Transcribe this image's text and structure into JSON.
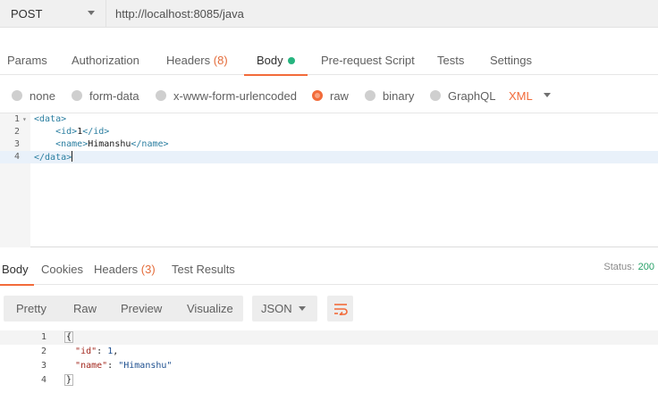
{
  "request": {
    "method": "POST",
    "url": "http://localhost:8085/java"
  },
  "request_tabs": {
    "params": "Params",
    "authorization": "Authorization",
    "headers": "Headers",
    "headers_count": "(8)",
    "body": "Body",
    "prerequest": "Pre-request Script",
    "tests": "Tests",
    "settings": "Settings"
  },
  "body_types": {
    "none": "none",
    "form_data": "form-data",
    "urlencoded": "x-www-form-urlencoded",
    "raw": "raw",
    "binary": "binary",
    "graphql": "GraphQL",
    "selected": "raw",
    "format": "XML"
  },
  "editor": {
    "lines": [
      {
        "number": "1",
        "indent": "",
        "open": "<data>",
        "text": "",
        "close": ""
      },
      {
        "number": "2",
        "indent": "    ",
        "open": "<id>",
        "text": "1",
        "close": "</id>"
      },
      {
        "number": "3",
        "indent": "    ",
        "open": "<name>",
        "text": "Himanshu",
        "close": "</name>"
      },
      {
        "number": "4",
        "indent": "",
        "open": "</data>",
        "text": "",
        "close": ""
      }
    ]
  },
  "response_tabs": {
    "body": "Body",
    "cookies": "Cookies",
    "headers": "Headers",
    "headers_count": "(3)",
    "test_results": "Test Results"
  },
  "status": {
    "label": "Status:",
    "code": "200"
  },
  "response_view": {
    "pretty": "Pretty",
    "raw": "Raw",
    "preview": "Preview",
    "visualize": "Visualize",
    "format": "JSON"
  },
  "response_body": {
    "line_numbers": [
      "1",
      "2",
      "3",
      "4"
    ],
    "open_brace": "{",
    "close_brace": "}",
    "fields": [
      {
        "key": "\"id\"",
        "value": "1"
      },
      {
        "key": "\"name\"",
        "value": "\"Himanshu\""
      }
    ]
  },
  "colors": {
    "accent": "#f26b3a",
    "status_ok": "#26a067",
    "active_dot": "#26b47f"
  },
  "icons": [
    "chevron-down-icon",
    "radio-icon",
    "word-wrap-icon"
  ]
}
